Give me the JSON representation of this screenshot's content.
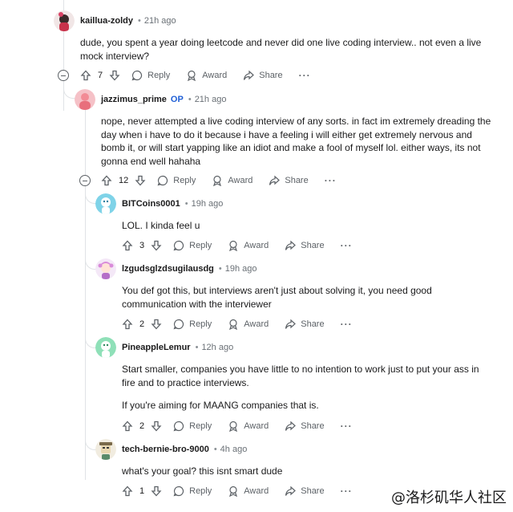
{
  "actions": {
    "reply": "Reply",
    "award": "Award",
    "share": "Share",
    "more": "···"
  },
  "comments": [
    {
      "author": "kaillua-zoldy",
      "op": "",
      "time": "21h ago",
      "score": "7",
      "body": [
        "dude, you spent a year doing leetcode and never did one live coding interview.. not even a live mock interview?"
      ]
    },
    {
      "author": "jazzimus_prime",
      "op": "OP",
      "time": "21h ago",
      "score": "12",
      "body": [
        "nope, never attempted a live coding interview of any sorts. in fact im extremely dreading the day when i have to do it because i have a feeling i will either get extremely nervous and bomb it, or will start yapping like an idiot and make a fool of myself lol. either ways, its not gonna end well hahaha"
      ]
    },
    {
      "author": "BITCoins0001",
      "op": "",
      "time": "19h ago",
      "score": "3",
      "body": [
        "LOL. I kinda feel u"
      ]
    },
    {
      "author": "lzgudsglzdsugilausdg",
      "op": "",
      "time": "19h ago",
      "score": "2",
      "body": [
        "You def got this, but interviews aren't just about solving it, you need good communication with the interviewer"
      ]
    },
    {
      "author": "PineappleLemur",
      "op": "",
      "time": "12h ago",
      "score": "2",
      "body": [
        "Start smaller, companies you have little to no intention to work just to put your ass in fire and to practice interviews.",
        "If you're aiming for MAANG companies that is."
      ]
    },
    {
      "author": "tech-bernie-bro-9000",
      "op": "",
      "time": "4h ago",
      "score": "1",
      "body": [
        "what's your goal? this isnt smart dude"
      ]
    }
  ],
  "watermark": "@洛杉矶华人社区"
}
